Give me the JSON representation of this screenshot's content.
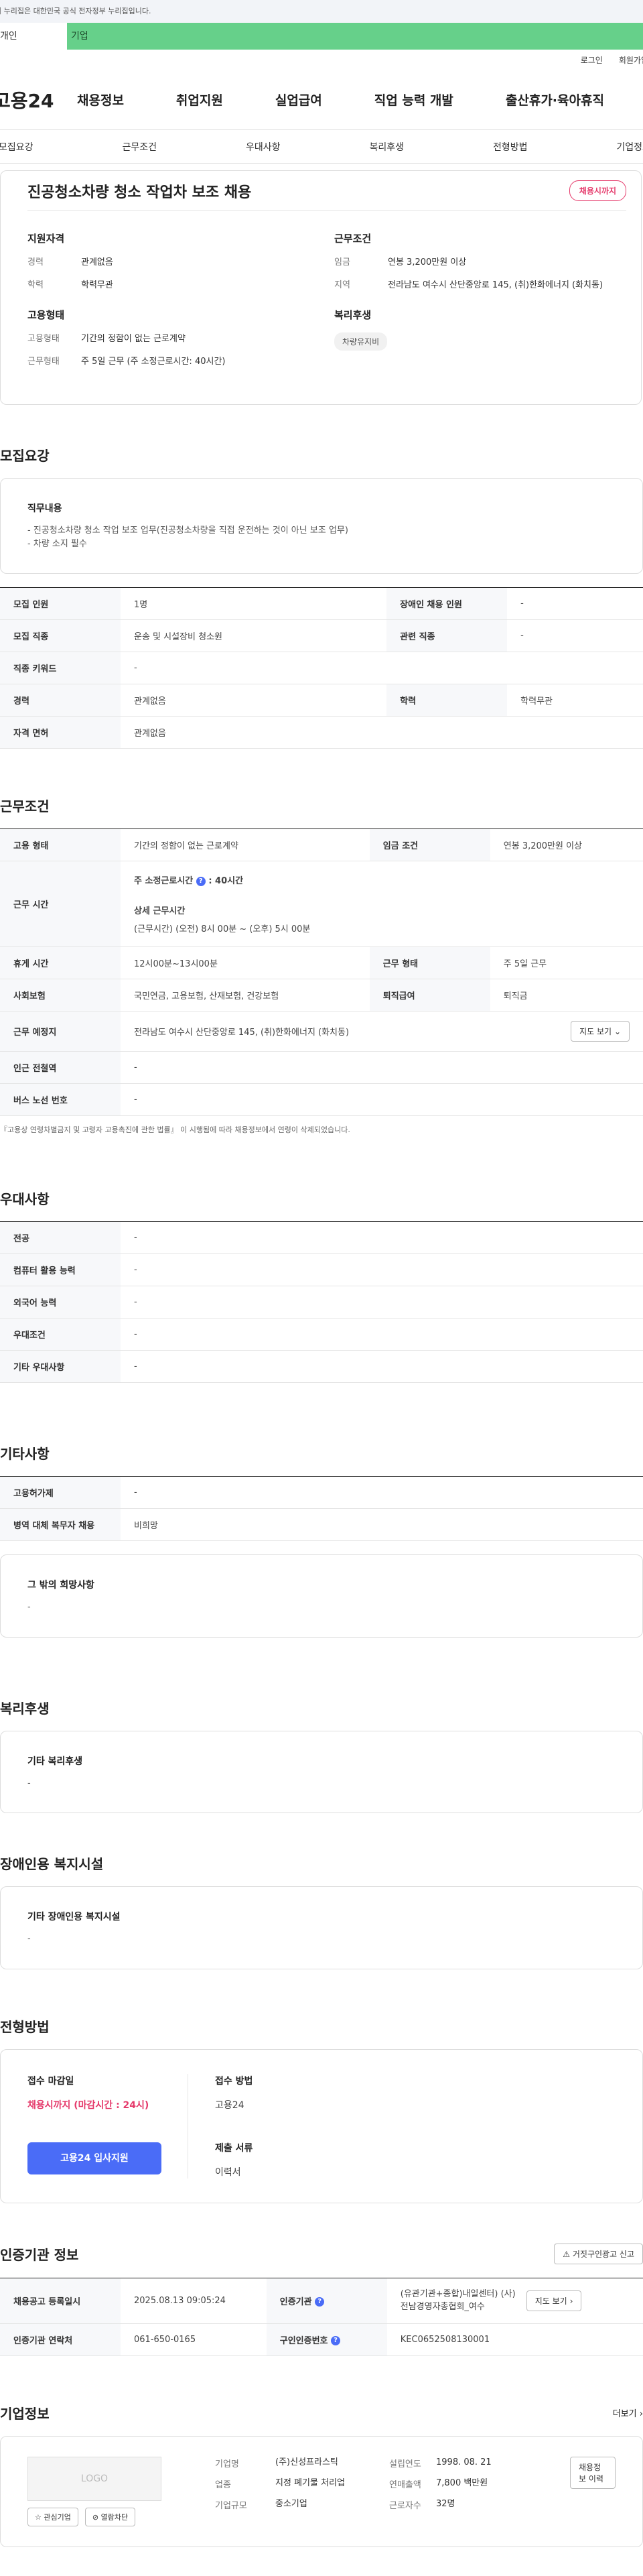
{
  "gov_bar": "이 누리집은 대한민국 공식 전자정부 누리집입니다.",
  "tabs": [
    "개인",
    "기업"
  ],
  "util": [
    "로그인",
    "회원가입"
  ],
  "logo": "고용24",
  "gnb": [
    "채용정보",
    "취업지원",
    "실업급여",
    "직업 능력 개발",
    "출산휴가·육아휴직"
  ],
  "subnav": [
    "모집요강",
    "근무조건",
    "우대사항",
    "복리후생",
    "전형방법",
    "기업정보"
  ],
  "summary": {
    "title": "진공청소차량 청소 작업차 보조 채용",
    "badge": "채용시까지",
    "qual_title": "지원자격",
    "qual": [
      [
        "경력",
        "관계없음"
      ],
      [
        "학력",
        "학력무관"
      ]
    ],
    "cond_title": "근무조건",
    "cond": [
      [
        "임금",
        "연봉 3,200만원 이상"
      ],
      [
        "지역",
        "전라남도 여수시 산단중앙로 145, (취)한화에너지 (화치동)"
      ]
    ],
    "emp_title": "고용형태",
    "emp": [
      [
        "고용형태",
        "기간의 정함이 없는 근로계약"
      ],
      [
        "근무형태",
        "주 5일 근무 (주 소정근로시간: 40시간)"
      ]
    ],
    "welfare_title": "복리후생",
    "welfare_chip": "차량유지비"
  },
  "recruit": {
    "title": "모집요강",
    "duty_title": "직무내용",
    "duty_lines": [
      "- 진공청소차량 청소 작업 보조 업무(진공청소차량을 직접 운전하는 것이 아닌 보조 업무)",
      "- 차량 소지 필수"
    ],
    "rows": [
      [
        "모집 인원",
        "1명",
        "장애인 채용 인원",
        "-"
      ],
      [
        "모집 직종",
        "운송 및 시설장비 청소원",
        "관련 직종",
        "-"
      ],
      [
        "직종 키워드",
        "-"
      ],
      [
        "경력",
        "관계없음",
        "학력",
        "학력무관"
      ],
      [
        "자격 면허",
        "관계없음"
      ]
    ]
  },
  "work": {
    "title": "근무조건",
    "r1": [
      "고용 형태",
      "기간의 정함이 없는 근로계약",
      "임금 조건",
      "연봉 3,200만원 이상"
    ],
    "hours_label": "근무 시간",
    "hours_main_label": "주 소정근로시간",
    "hours_main_value": ": 40시간",
    "hours_detail_label": "상세 근무시간",
    "hours_detail": "(근무시간) (오전) 8시 00분 ~ (오후) 5시 00분",
    "r3": [
      "휴게 시간",
      "12시00분~13시00분",
      "근무 형태",
      "주 5일 근무"
    ],
    "r4": [
      "사회보험",
      "국민연금, 고용보험, 산재보험, 건강보험",
      "퇴직급여",
      "퇴직금"
    ],
    "place_label": "근무 예정지",
    "place_value": "전라남도 여수시 산단중앙로 145, (취)한화에너지 (화치동)",
    "map_btn": "지도 보기",
    "r6": [
      "인근 전철역",
      "-"
    ],
    "r7": [
      "버스 노선 번호",
      "-"
    ],
    "note": "『고용상 연령차별금지 및 고령자 고용촉진에 관한 법률』 이 시행됨에 따라 채용정보에서 연령이 삭제되었습니다."
  },
  "pref": {
    "title": "우대사항",
    "rows": [
      [
        "전공",
        "-"
      ],
      [
        "컴퓨터 활용 능력",
        "-"
      ],
      [
        "외국어 능력",
        "-"
      ],
      [
        "우대조건",
        "-"
      ],
      [
        "기타 우대사항",
        "-"
      ]
    ]
  },
  "etc": {
    "title": "기타사항",
    "rows": [
      [
        "고용허가제",
        "-"
      ],
      [
        "병역 대체 복무자 채용",
        "비희망"
      ]
    ],
    "hope_title": "그 밖의 희망사항",
    "hope_value": "-"
  },
  "welfare": {
    "title": "복리후생",
    "box_title": "기타 복리후생",
    "box_value": "-"
  },
  "disabled": {
    "title": "장애인용 복지시설",
    "box_title": "기타 장애인용 복지시설",
    "box_value": "-"
  },
  "process": {
    "title": "전형방법",
    "deadline_title": "접수 마감일",
    "deadline": "채용시까지 (마감시간 : 24시)",
    "apply_btn": "고용24 입사지원",
    "method_title": "접수 방법",
    "method": "고용24",
    "docs_title": "제출 서류",
    "docs": "이력서"
  },
  "cert": {
    "title": "인증기관 정보",
    "report_btn": "거짓구인광고 신고",
    "r1": [
      "채용공고 등록일시",
      "2025.08.13 09:05:24",
      "인증기관",
      "(유관기관+종합)내일센터) (사)전남경영자총협회_여수"
    ],
    "map_btn": "지도 보기",
    "r2": [
      "인증기관 연락처",
      "061-650-0165",
      "구인인증번호",
      "KEC0652508130001"
    ]
  },
  "company": {
    "title": "기업정보",
    "more": "더보기",
    "logo": "LOGO",
    "btn_interest": "관심기업",
    "btn_block": "열람차단",
    "info": [
      [
        "기업명",
        "(주)신성프라스틱",
        "설립연도",
        "1998. 08. 21"
      ],
      [
        "업종",
        "지정 폐기물 처리업",
        "연매출액",
        "7,800 백만원"
      ],
      [
        "기업규모",
        "중소기업",
        "근로자수",
        "32명"
      ]
    ],
    "recruit_btn": "채용정보 이력"
  },
  "colors": {
    "accent": "#4a6cf7",
    "pink": "#e53a6b",
    "green": "#66d08a"
  }
}
